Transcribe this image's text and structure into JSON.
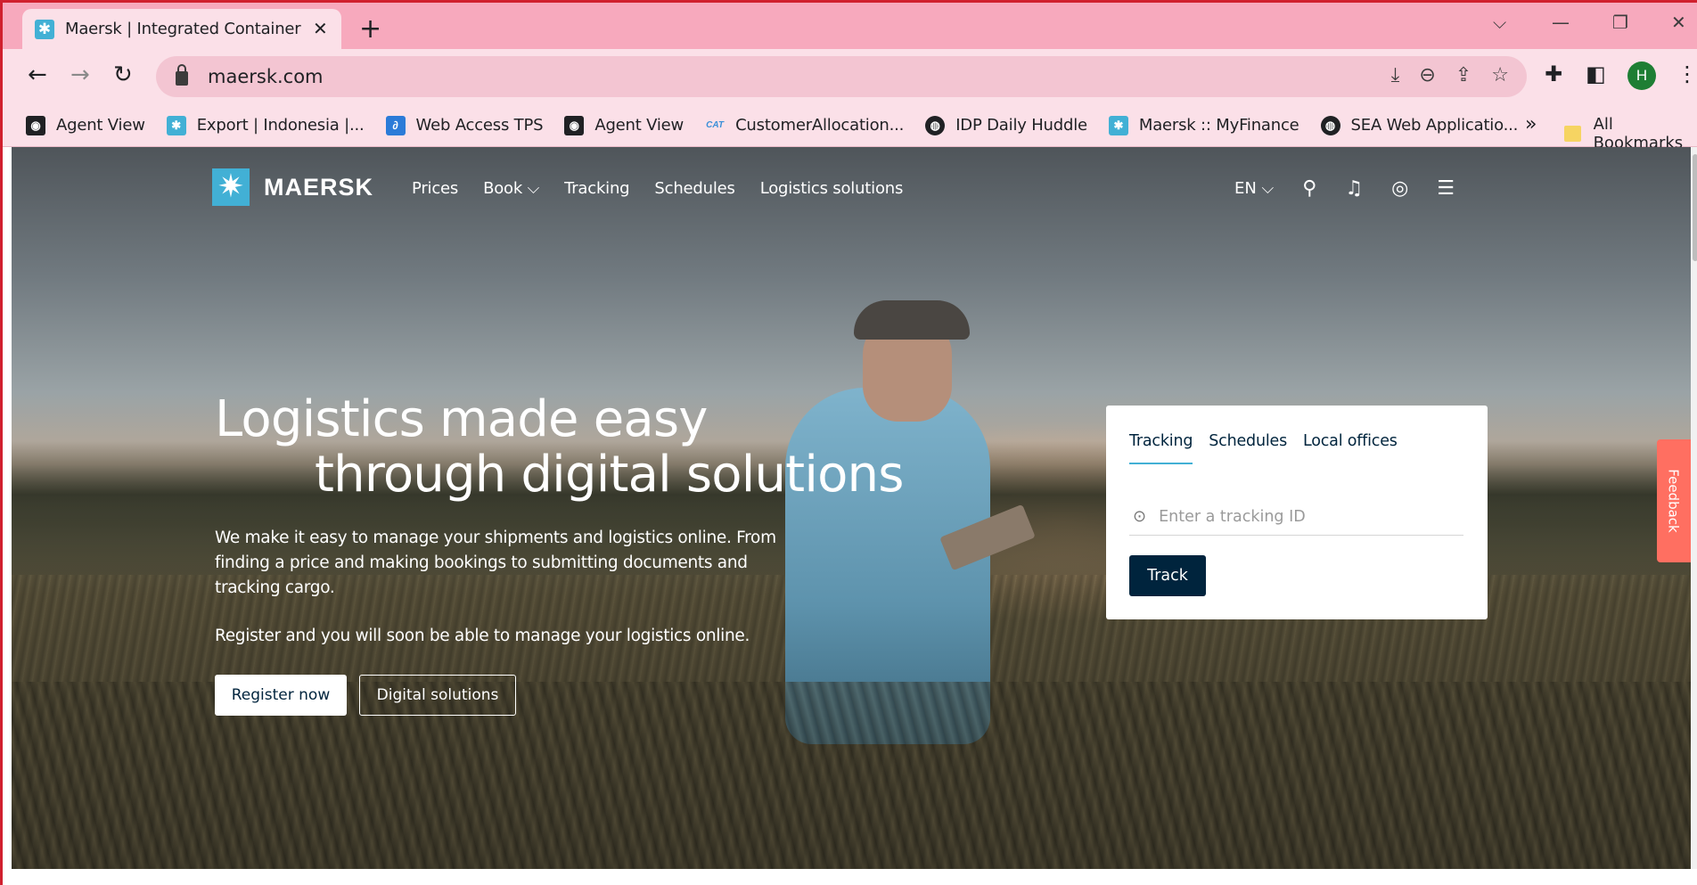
{
  "browser": {
    "tab_title": "Maersk | Integrated Container Lo",
    "tab_close": "✕",
    "new_tab": "+",
    "url": "maersk.com",
    "profile_initial": "H",
    "window_controls": {
      "dropdown": "⌵",
      "minimize": "—",
      "restore": "❐",
      "close": "✕"
    },
    "nav": {
      "back": "←",
      "forward": "→",
      "reload": "↻"
    },
    "omni_icons": {
      "download": "⤓",
      "zoom": "⊖",
      "share": "⇪",
      "bookmark": "☆"
    },
    "toolbar_icons": {
      "extensions": "✚",
      "sidebar": "◧",
      "menu": "⋮"
    }
  },
  "bookmarks": [
    {
      "label": "Agent View",
      "icon": "agent-icon",
      "color": "#202124",
      "glyph": "◉"
    },
    {
      "label": "Export | Indonesia |...",
      "icon": "maersk-star-icon",
      "color": "#42b0d5",
      "glyph": "✱"
    },
    {
      "label": "Web Access TPS",
      "icon": "link-icon",
      "color": "#2b7bd8",
      "glyph": "∂"
    },
    {
      "label": "Agent View",
      "icon": "agent-icon",
      "color": "#202124",
      "glyph": "◉"
    },
    {
      "label": "CustomerAllocation...",
      "icon": "cat-icon",
      "color": "#3a8fd8",
      "glyph": "CAT"
    },
    {
      "label": "IDP Daily Huddle",
      "icon": "globe-icon",
      "color": "#202124",
      "glyph": "◍"
    },
    {
      "label": "Maersk :: MyFinance",
      "icon": "maersk-star-icon",
      "color": "#42b0d5",
      "glyph": "✱"
    },
    {
      "label": "SEA Web Applicatio...",
      "icon": "globe-icon",
      "color": "#202124",
      "glyph": "◍"
    }
  ],
  "bookmarks_more": "»",
  "all_bookmarks": "All Bookmarks",
  "site": {
    "logo_glyph": "✷",
    "logo_text": "MAERSK",
    "menu": [
      "Prices",
      "Book ⌵",
      "Tracking",
      "Schedules",
      "Logistics solutions"
    ],
    "lang": "EN ⌵",
    "icons": {
      "search": "⚲",
      "bell": "♫",
      "account": "◎",
      "menu": "☰"
    }
  },
  "hero": {
    "headline_line1": "Logistics made easy",
    "headline_line2": "through digital solutions",
    "subtext": "We make it easy to manage your shipments and logistics online. From finding a price and making bookings to submitting documents and tracking cargo.",
    "subtext2": "Register and you will soon be able to manage your logistics online.",
    "register_label": "Register now",
    "digital_label": "Digital solutions"
  },
  "track_card": {
    "tabs": [
      "Tracking",
      "Schedules",
      "Local offices"
    ],
    "placeholder": "Enter a tracking ID",
    "pin": "⊙",
    "button": "Track"
  },
  "feedback": "Feedback",
  "colors": {
    "accent": "#42b0d5",
    "navy": "#00243d",
    "feedback": "#ff6f61",
    "chrome": "#f7a9bd"
  }
}
